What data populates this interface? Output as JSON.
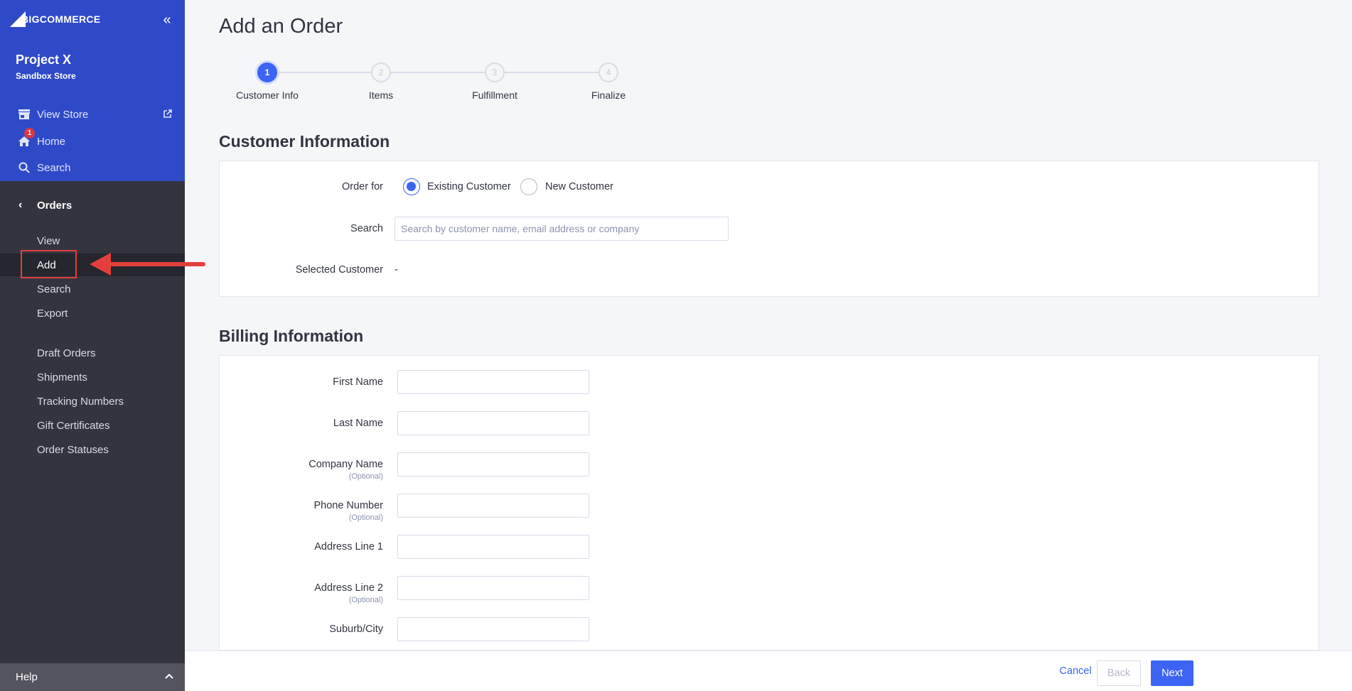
{
  "brand": {
    "logo_text": "BIGCOMMERCE"
  },
  "store": {
    "name": "Project X",
    "subtitle": "Sandbox Store"
  },
  "top_nav": [
    {
      "label": "View Store",
      "icon": "storefront-icon"
    },
    {
      "label": "Home",
      "icon": "home-icon",
      "badge": "1"
    },
    {
      "label": "Search",
      "icon": "search-icon"
    }
  ],
  "orders_section": {
    "title": "Orders",
    "items": [
      "View",
      "Add",
      "Search",
      "Export"
    ],
    "active_item": "Add",
    "more_items": [
      "Draft Orders",
      "Shipments",
      "Tracking Numbers",
      "Gift Certificates",
      "Order Statuses"
    ]
  },
  "help": {
    "label": "Help"
  },
  "page": {
    "title": "Add an Order"
  },
  "stepper": [
    {
      "number": "1",
      "label": "Customer Info",
      "active": true
    },
    {
      "number": "2",
      "label": "Items",
      "active": false
    },
    {
      "number": "3",
      "label": "Fulfillment",
      "active": false
    },
    {
      "number": "4",
      "label": "Finalize",
      "active": false
    }
  ],
  "customer_info": {
    "title": "Customer Information",
    "order_for_label": "Order for",
    "options": [
      "Existing Customer",
      "New Customer"
    ],
    "selected_option": "Existing Customer",
    "search_label": "Search",
    "search_placeholder": "Search by customer name, email address or company",
    "selected_customer_label": "Selected Customer",
    "selected_customer_value": "-"
  },
  "billing_info": {
    "title": "Billing Information",
    "optional_text": "(Optional)",
    "fields": [
      {
        "label": "First Name",
        "optional": false,
        "value": ""
      },
      {
        "label": "Last Name",
        "optional": false,
        "value": ""
      },
      {
        "label": "Company Name",
        "optional": true,
        "value": ""
      },
      {
        "label": "Phone Number",
        "optional": true,
        "value": ""
      },
      {
        "label": "Address Line 1",
        "optional": false,
        "value": ""
      },
      {
        "label": "Address Line 2",
        "optional": true,
        "value": ""
      },
      {
        "label": "Suburb/City",
        "optional": false,
        "value": ""
      }
    ]
  },
  "footer": {
    "cancel": "Cancel",
    "back": "Back",
    "next": "Next"
  },
  "colors": {
    "sidebar_top": "#2f4ac8",
    "sidebar": "#34343f",
    "accent": "#3c64f4",
    "annotation": "#e3403c"
  }
}
